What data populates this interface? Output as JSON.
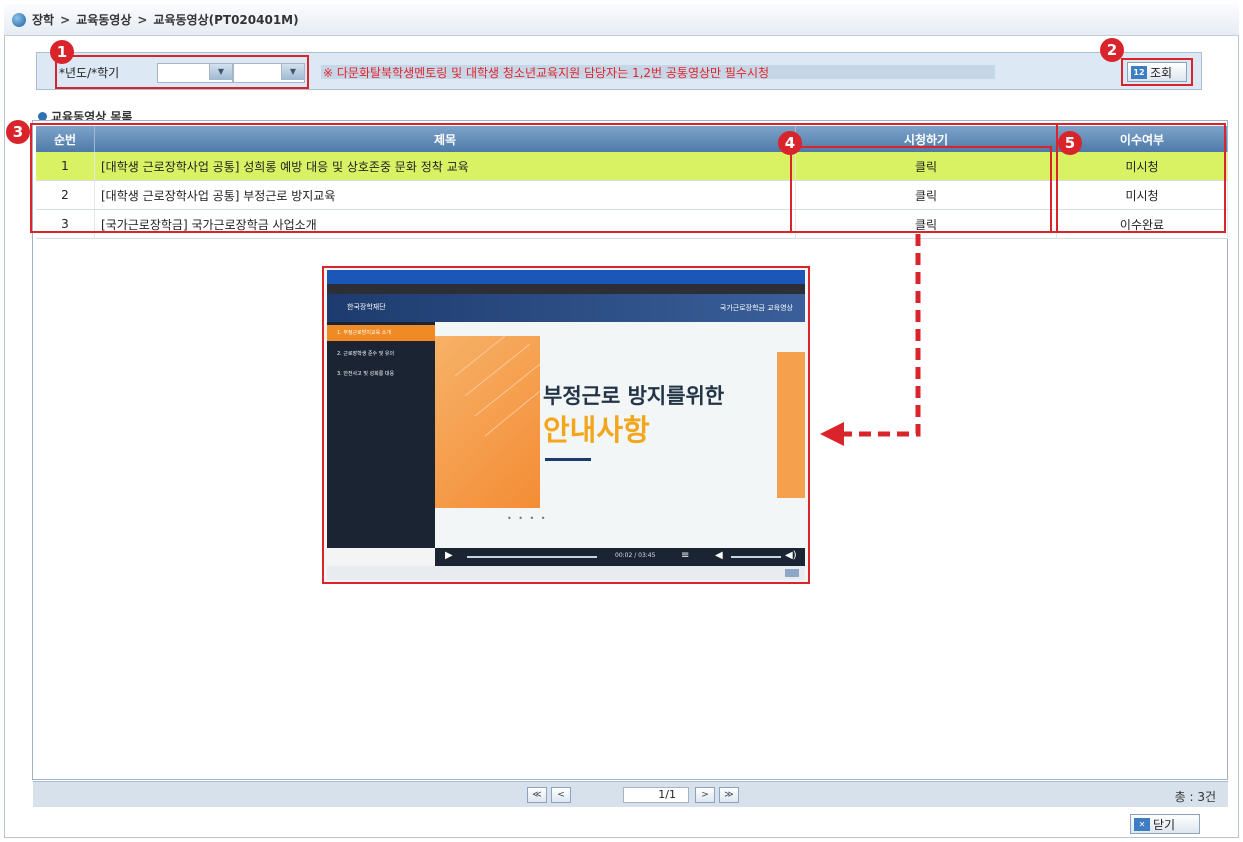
{
  "breadcrumb": [
    "장학",
    "교육동영상",
    "교육동영상(PT020401M)"
  ],
  "breadcrumb_sep": ">",
  "search": {
    "label": "*년도/*학기",
    "year_value": "",
    "semester_value": "",
    "notice": "※ 다문화탈북학생멘토링 및 대학생 청소년교육지원 담당자는 1,2번 공통영상만 필수시청",
    "search_button": "조회",
    "search_icon_text": "12"
  },
  "markers": [
    "1",
    "2",
    "3",
    "4",
    "5"
  ],
  "section_title": "교육동영상 목록",
  "table": {
    "headers": [
      "순번",
      "제목",
      "시청하기",
      "이수여부"
    ],
    "rows": [
      {
        "no": "1",
        "title": "[대학생 근로장학사업 공통] 성희롱 예방 대응 및 상호존중 문화 정착 교육",
        "watch": "클릭",
        "status": "미시청",
        "selected": true
      },
      {
        "no": "2",
        "title": "[대학생 근로장학사업 공통] 부정근로 방지교육",
        "watch": "클릭",
        "status": "미시청",
        "selected": false
      },
      {
        "no": "3",
        "title": "[국가근로장학금] 국가근로장학금 사업소개",
        "watch": "클릭",
        "status": "이수완료",
        "selected": false
      }
    ]
  },
  "pagination": {
    "first": "≪",
    "prev": "<",
    "page": "1/1",
    "next": ">",
    "last": "≫",
    "total": "총 : 3건"
  },
  "close_button": "닫기",
  "preview": {
    "logo_text": "한국장학재단",
    "header_title": "국가근로장학금 교육영상",
    "menu": [
      "1. 부정근로방지교육 소개",
      "2. 근로장학생 준수 및 유의",
      "3. 안전사고 및 성희롱 대응"
    ],
    "slide_line1": "부정근로 방지를위한",
    "slide_line2": "안내사항",
    "slide_dots": "• • • •",
    "time": "00:02 / 03:45"
  },
  "colors": {
    "accent_red": "#d9242c",
    "selected_row": "#d8f264",
    "header_blue": "#4f7aa8",
    "slide_orange": "#f3a51b"
  }
}
